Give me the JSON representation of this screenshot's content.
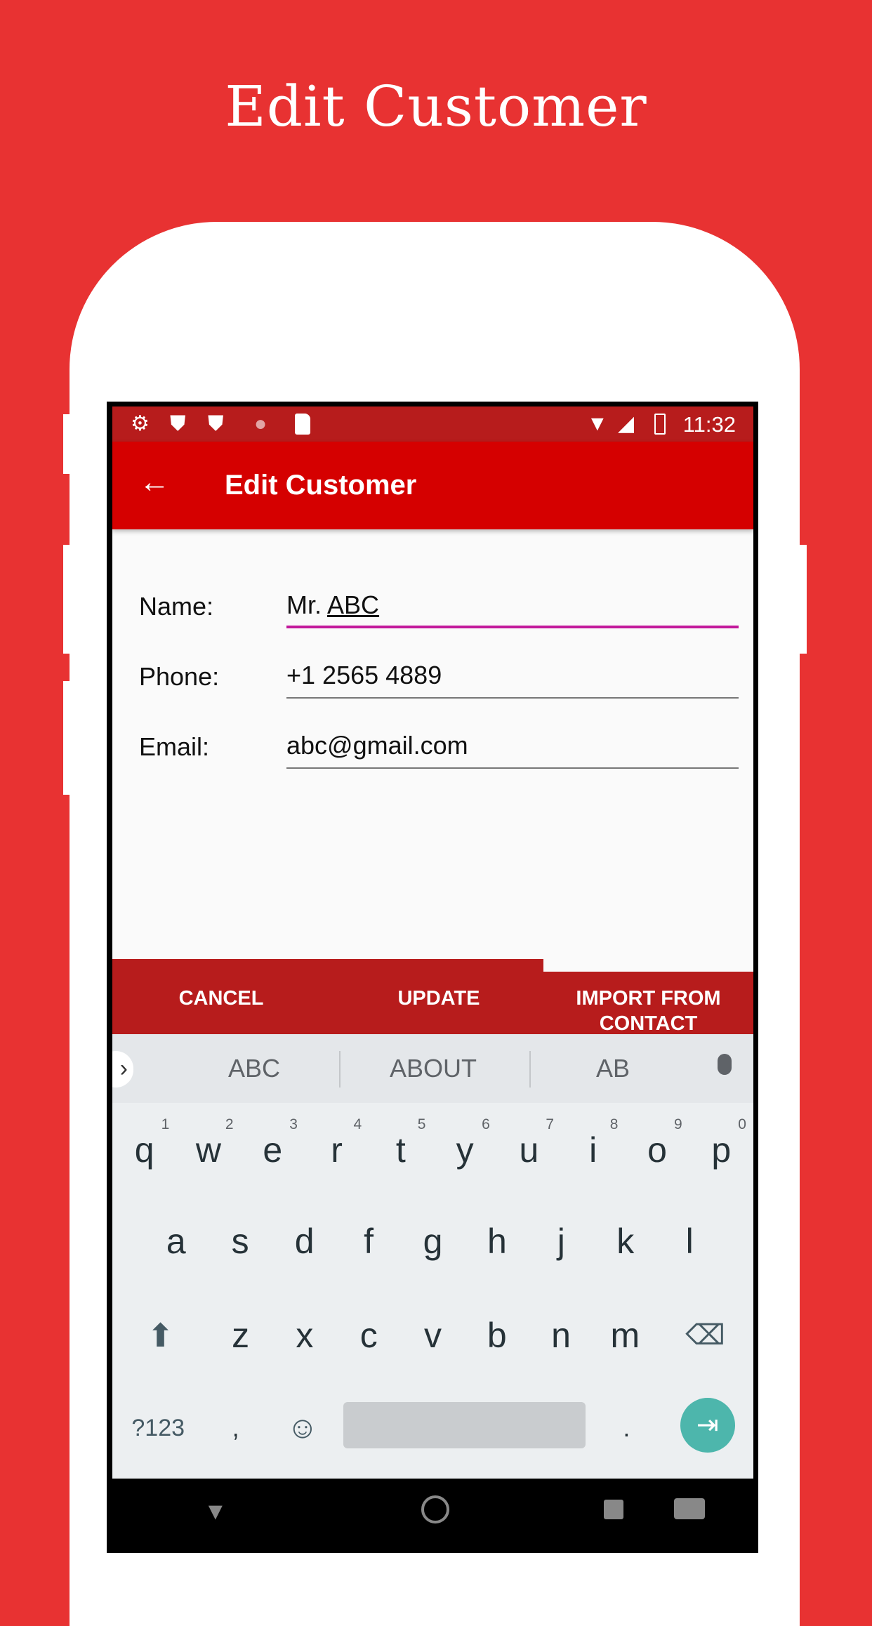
{
  "hero": {
    "title": "Edit Customer"
  },
  "status": {
    "time": "11:32",
    "icons": [
      "gear-icon",
      "shield-play-icon",
      "shield-play-icon",
      "loading-circle-icon",
      "sd-card-icon",
      "wifi-off-icon",
      "signal-icon",
      "battery-charging-icon"
    ]
  },
  "appbar": {
    "title": "Edit Customer",
    "back_icon": "arrow-left-icon"
  },
  "form": {
    "name": {
      "label": "Name:",
      "prefix": "Mr. ",
      "value_underlined": "ABC"
    },
    "phone": {
      "label": "Phone:",
      "value": "+1 2565 4889"
    },
    "email": {
      "label": "Email:",
      "value": "abc@gmail.com"
    }
  },
  "buttons": {
    "cancel": "CANCEL",
    "update": "UPDATE",
    "import_line1": "IMPORT FROM",
    "import_line2": "CONTACT"
  },
  "keyboard": {
    "suggestions": [
      "ABC",
      "ABOUT",
      "AB"
    ],
    "row1": [
      {
        "k": "q",
        "h": "1"
      },
      {
        "k": "w",
        "h": "2"
      },
      {
        "k": "e",
        "h": "3"
      },
      {
        "k": "r",
        "h": "4"
      },
      {
        "k": "t",
        "h": "5"
      },
      {
        "k": "y",
        "h": "6"
      },
      {
        "k": "u",
        "h": "7"
      },
      {
        "k": "i",
        "h": "8"
      },
      {
        "k": "o",
        "h": "9"
      },
      {
        "k": "p",
        "h": "0"
      }
    ],
    "row2": [
      "a",
      "s",
      "d",
      "f",
      "g",
      "h",
      "j",
      "k",
      "l"
    ],
    "row3": [
      "z",
      "x",
      "c",
      "v",
      "b",
      "n",
      "m"
    ],
    "symbols": "?123",
    "comma": ",",
    "period": "."
  },
  "colors": {
    "background": "#E83232",
    "status_bar": "#B71C1C",
    "app_bar": "#D50000",
    "accent": "#C2189B",
    "enter": "#4DB6AC"
  }
}
